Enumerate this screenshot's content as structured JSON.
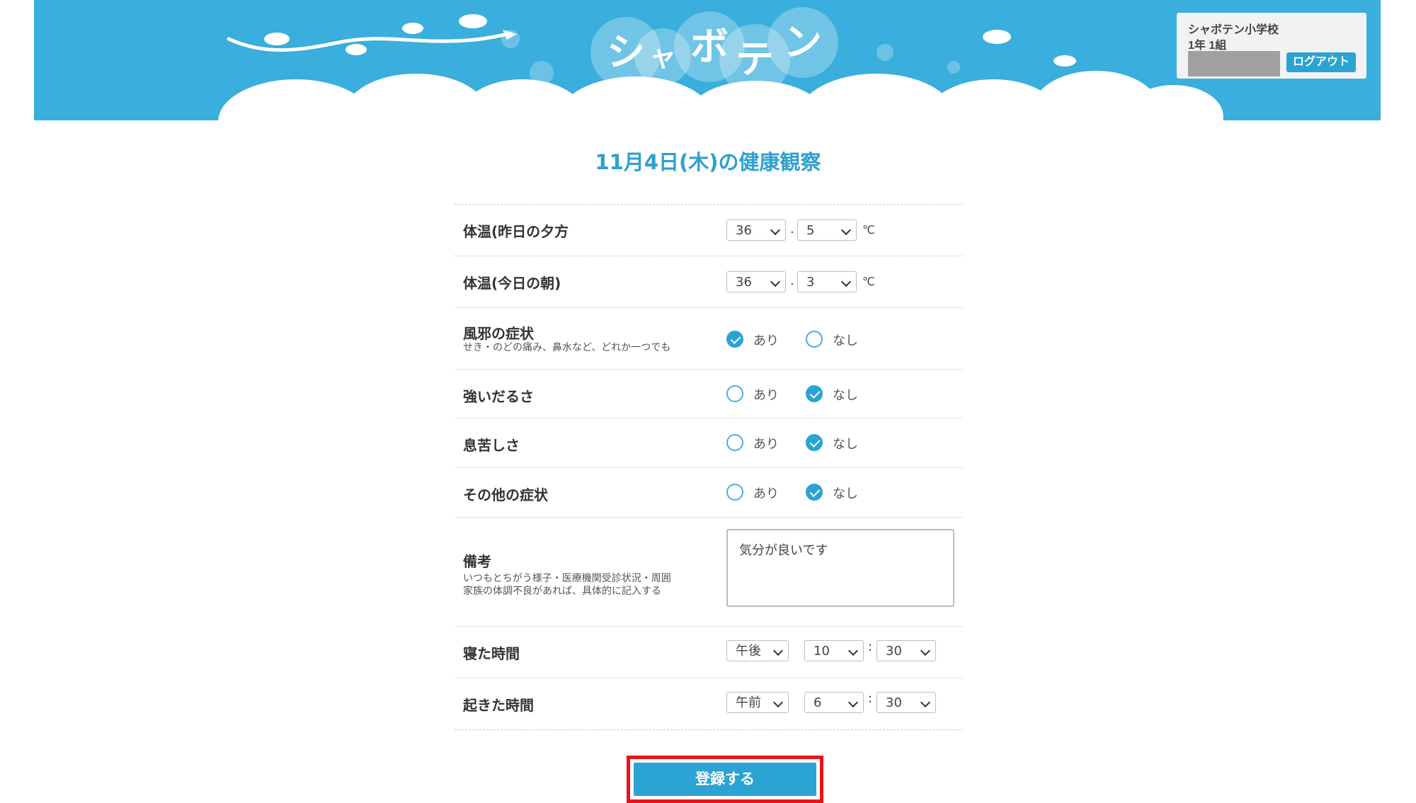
{
  "app": {
    "logo_chars": [
      "シ",
      "ャ",
      "ボ",
      "テ",
      "ン"
    ],
    "logo_text": "シャボテン",
    "accent_color": "#3aaedc"
  },
  "account": {
    "school": "シャボテン小学校",
    "class": "1年 1組",
    "logout_label": "ログアウト"
  },
  "page": {
    "title": "11月4日(木)の健康観察"
  },
  "form": {
    "temp_evening": {
      "label": "体温(昨日の夕方",
      "whole": "36",
      "dot": ".",
      "decimal": "5",
      "unit": "℃"
    },
    "temp_morning": {
      "label": "体温(今日の朝)",
      "whole": "36",
      "dot": ".",
      "decimal": "3",
      "unit": "℃"
    },
    "cold": {
      "label": "風邪の症状",
      "sub": "せき・のどの痛み、鼻水など、どれか一つでも",
      "yes": "あり",
      "no": "なし",
      "selected": "yes"
    },
    "fatigue": {
      "label": "強いだるさ",
      "yes": "あり",
      "no": "なし",
      "selected": "no"
    },
    "breath": {
      "label": "息苦しさ",
      "yes": "あり",
      "no": "なし",
      "selected": "no"
    },
    "other": {
      "label": "その他の症状",
      "yes": "あり",
      "no": "なし",
      "selected": "no"
    },
    "notes": {
      "label": "備考",
      "sub1": "いつもとちがう様子・医療機関受診状況・周囲",
      "sub2": "家族の体調不良があれば、具体的に記入する",
      "value": "気分が良いです"
    },
    "sleep": {
      "label": "寝た時間",
      "ampm": "午後",
      "hour": "10",
      "colon": ":",
      "minute": "30"
    },
    "wake": {
      "label": "起きた時間",
      "ampm": "午前",
      "hour": "6",
      "colon": ":",
      "minute": "30"
    }
  },
  "submit_label": "登録する"
}
